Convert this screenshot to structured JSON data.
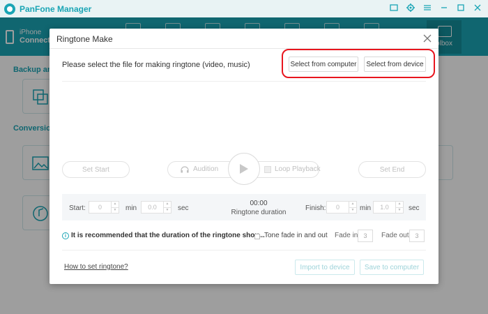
{
  "app": {
    "title": "PanFone Manager",
    "accent_color": "#1aa5b5"
  },
  "window_controls": [
    "feedback-icon",
    "gear-icon",
    "menu-icon",
    "minimize-icon",
    "maximize-icon",
    "close-icon"
  ],
  "header": {
    "device_name": "iPhone",
    "device_status": "Connecte",
    "active_tab": "olbox"
  },
  "background": {
    "section_backup": "Backup and",
    "section_conversion": "Conversion"
  },
  "dialog": {
    "title": "Ringtone Make",
    "prompt": "Please select the file for making ringtone (video, music)",
    "select_from_computer": "Select from computer",
    "select_from_device": "Select from device",
    "highlight_color": "#e8151e",
    "set_start": "Set Start",
    "audition": "Audition",
    "loop_playback": "Loop Playback",
    "set_end": "Set End",
    "time": {
      "start_label": "Start:",
      "start_min": "0",
      "min_label": "min",
      "start_sec": "0.0",
      "sec_label": "sec",
      "duration_value": "00:00",
      "duration_label": "Ringtone duration",
      "finish_label": "Finish:",
      "finish_min": "0",
      "finish_min_label": "min",
      "finish_sec": "1.0",
      "finish_sec_label": "sec"
    },
    "recommend_text": "It is recommended that the duration of the ringtone shou...",
    "tone_fade_label": "Tone fade in and out",
    "fade_in_label": "Fade in",
    "fade_in_value": "3",
    "fade_out_label": "Fade out",
    "fade_out_value": "3",
    "how_to_link": "How to set ringtone?",
    "import_button": "Import to device",
    "save_button": "Save to computer"
  }
}
